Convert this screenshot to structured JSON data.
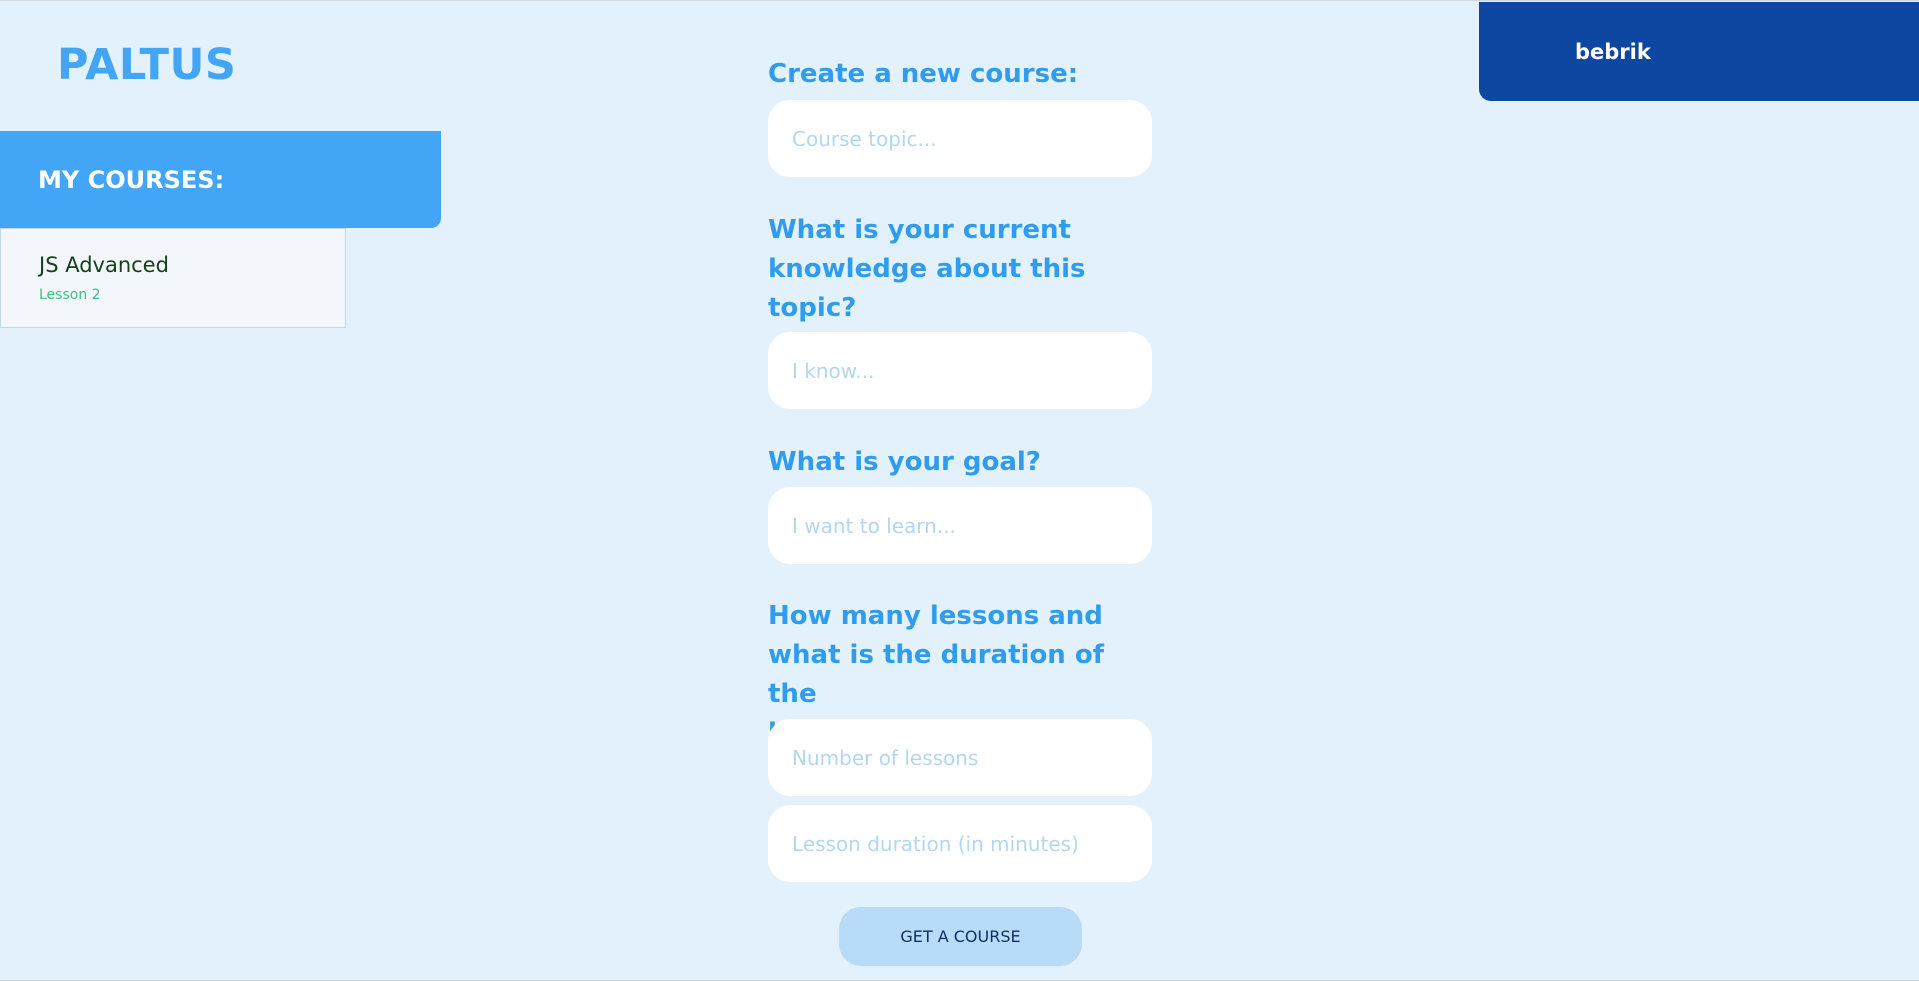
{
  "app": {
    "logo": "PALTUS"
  },
  "sidebar": {
    "header": "MY COURSES:",
    "courses": [
      {
        "title": "JS Advanced",
        "subtitle": "Lesson 2"
      }
    ]
  },
  "user": {
    "name": "bebrik"
  },
  "form": {
    "topic_label": "Create a new course:",
    "topic_placeholder": "Course topic...",
    "knowledge_label": "What is your current\nknowledge about this\ntopic?",
    "knowledge_placeholder": "I know...",
    "goal_label": "What is your goal?",
    "goal_placeholder": "I want to learn...",
    "lessons_label": "How many lessons and\nwhat is the duration of the\nlesson?",
    "lessons_count_placeholder": "Number of lessons",
    "lesson_duration_placeholder": "Lesson duration (in minutes)",
    "submit_label": "GET A COURSE"
  },
  "colors": {
    "background": "#e2f1fb",
    "accent": "#42a5f5",
    "label": "#2f9ced",
    "user_panel": "#0d47a1",
    "button": "#b8dcf7",
    "lesson_green": "#41c07c"
  }
}
